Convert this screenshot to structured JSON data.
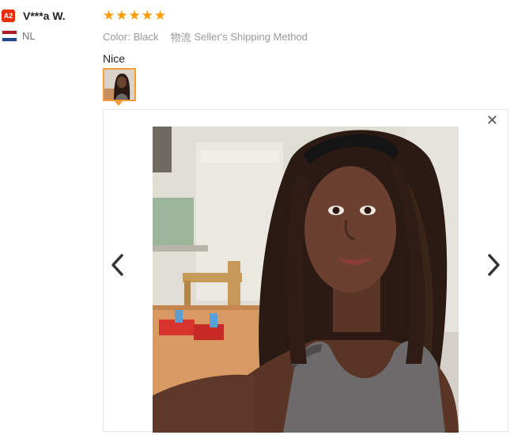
{
  "buyer": {
    "level_badge": "A2",
    "name": "V***a W.",
    "country": "NL",
    "flag_colors": [
      "#ae1c28",
      "#ffffff",
      "#21468b"
    ]
  },
  "review": {
    "rating": 5,
    "rating_max": 5,
    "color_label": "Color:",
    "color_value": "Black",
    "shipping_label": "物流",
    "shipping_value": "Seller's Shipping Method",
    "text": "Nice"
  },
  "viewer": {
    "close_icon": "close-icon",
    "prev_icon": "chevron-left-icon",
    "next_icon": "chevron-right-icon"
  },
  "colors": {
    "star": "#ff9a00",
    "badge": "#e62e04",
    "thumb_border": "#f39c3a"
  }
}
